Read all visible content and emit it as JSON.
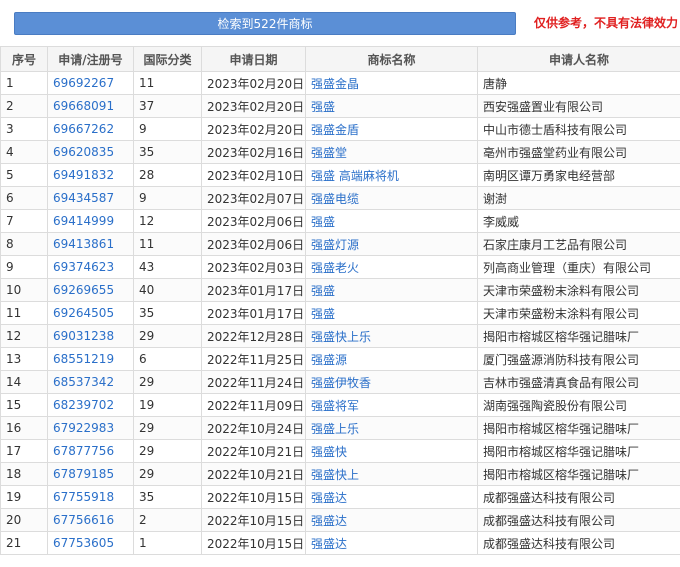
{
  "header": {
    "search_result_label": "检索到522件商标",
    "disclaimer": "仅供参考，不具有法律效力"
  },
  "table": {
    "columns": [
      "序号",
      "申请/注册号",
      "国际分类",
      "申请日期",
      "商标名称",
      "申请人名称"
    ],
    "rows": [
      {
        "no": "1",
        "reg": "69692267",
        "cls": "11",
        "date": "2023年02月20日",
        "mark": "强盛金晶",
        "applicant": "唐静"
      },
      {
        "no": "2",
        "reg": "69668091",
        "cls": "37",
        "date": "2023年02月20日",
        "mark": "强盛",
        "applicant": "西安强盛置业有限公司"
      },
      {
        "no": "3",
        "reg": "69667262",
        "cls": "9",
        "date": "2023年02月20日",
        "mark": "强盛金盾",
        "applicant": "中山市德士盾科技有限公司"
      },
      {
        "no": "4",
        "reg": "69620835",
        "cls": "35",
        "date": "2023年02月16日",
        "mark": "强盛堂",
        "applicant": "亳州市强盛堂药业有限公司"
      },
      {
        "no": "5",
        "reg": "69491832",
        "cls": "28",
        "date": "2023年02月10日",
        "mark": "强盛 高端麻将机",
        "applicant": "南明区谭万勇家电经营部"
      },
      {
        "no": "6",
        "reg": "69434587",
        "cls": "9",
        "date": "2023年02月07日",
        "mark": "强盛电缆",
        "applicant": "谢澍"
      },
      {
        "no": "7",
        "reg": "69414999",
        "cls": "12",
        "date": "2023年02月06日",
        "mark": "强盛",
        "applicant": "李威威"
      },
      {
        "no": "8",
        "reg": "69413861",
        "cls": "11",
        "date": "2023年02月06日",
        "mark": "强盛灯源",
        "applicant": "石家庄康月工艺品有限公司"
      },
      {
        "no": "9",
        "reg": "69374623",
        "cls": "43",
        "date": "2023年02月03日",
        "mark": "强盛老火",
        "applicant": "列高商业管理（重庆）有限公司"
      },
      {
        "no": "10",
        "reg": "69269655",
        "cls": "40",
        "date": "2023年01月17日",
        "mark": "强盛",
        "applicant": "天津市荣盛粉末涂料有限公司"
      },
      {
        "no": "11",
        "reg": "69264505",
        "cls": "35",
        "date": "2023年01月17日",
        "mark": "强盛",
        "applicant": "天津市荣盛粉末涂料有限公司"
      },
      {
        "no": "12",
        "reg": "69031238",
        "cls": "29",
        "date": "2022年12月28日",
        "mark": "强盛快上乐",
        "applicant": "揭阳市榕城区榕华强记腊味厂"
      },
      {
        "no": "13",
        "reg": "68551219",
        "cls": "6",
        "date": "2022年11月25日",
        "mark": "强盛源",
        "applicant": "厦门强盛源消防科技有限公司"
      },
      {
        "no": "14",
        "reg": "68537342",
        "cls": "29",
        "date": "2022年11月24日",
        "mark": "强盛伊牧香",
        "applicant": "吉林市强盛清真食品有限公司"
      },
      {
        "no": "15",
        "reg": "68239702",
        "cls": "19",
        "date": "2022年11月09日",
        "mark": "强盛将军",
        "applicant": "湖南强强陶瓷股份有限公司"
      },
      {
        "no": "16",
        "reg": "67922983",
        "cls": "29",
        "date": "2022年10月24日",
        "mark": "强盛上乐",
        "applicant": "揭阳市榕城区榕华强记腊味厂"
      },
      {
        "no": "17",
        "reg": "67877756",
        "cls": "29",
        "date": "2022年10月21日",
        "mark": "强盛快",
        "applicant": "揭阳市榕城区榕华强记腊味厂"
      },
      {
        "no": "18",
        "reg": "67879185",
        "cls": "29",
        "date": "2022年10月21日",
        "mark": "强盛快上",
        "applicant": "揭阳市榕城区榕华强记腊味厂"
      },
      {
        "no": "19",
        "reg": "67755918",
        "cls": "35",
        "date": "2022年10月15日",
        "mark": "强盛达",
        "applicant": "成都强盛达科技有限公司"
      },
      {
        "no": "20",
        "reg": "67756616",
        "cls": "2",
        "date": "2022年10月15日",
        "mark": "强盛达",
        "applicant": "成都强盛达科技有限公司"
      },
      {
        "no": "21",
        "reg": "67753605",
        "cls": "1",
        "date": "2022年10月15日",
        "mark": "强盛达",
        "applicant": "成都强盛达科技有限公司"
      }
    ]
  }
}
